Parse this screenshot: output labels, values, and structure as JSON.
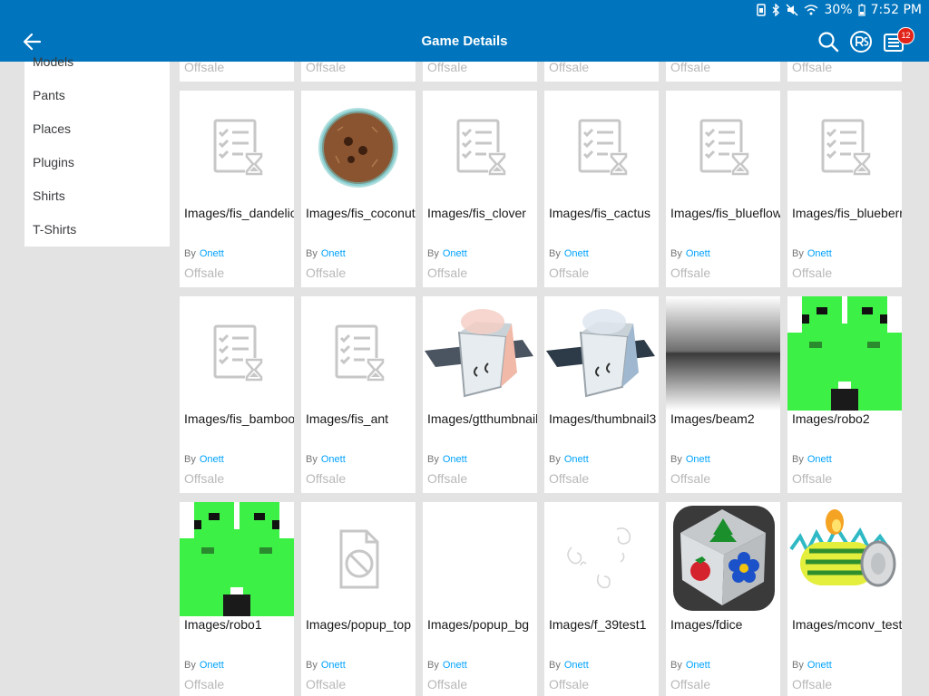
{
  "status": {
    "battery": "30%",
    "time": "7:52 PM"
  },
  "header": {
    "title": "Game Details",
    "notification_count": "12"
  },
  "sidebar": {
    "items": [
      "Models",
      "Pants",
      "Places",
      "Plugins",
      "Shirts",
      "T-Shirts"
    ]
  },
  "by_label": "By",
  "partial_row": [
    "Offsale",
    "Offsale",
    "Offsale",
    "Offsale",
    "Offsale",
    "Offsale"
  ],
  "items": [
    {
      "name": "Images/fis_dandelion",
      "creator": "Onett",
      "price": "Offsale",
      "thumb": "pending-icon"
    },
    {
      "name": "Images/fis_coconut",
      "creator": "Onett",
      "price": "Offsale",
      "thumb": "coconut-thumbnail"
    },
    {
      "name": "Images/fis_clover",
      "creator": "Onett",
      "price": "Offsale",
      "thumb": "pending-icon"
    },
    {
      "name": "Images/fis_cactus",
      "creator": "Onett",
      "price": "Offsale",
      "thumb": "pending-icon"
    },
    {
      "name": "Images/fis_blueflower",
      "creator": "Onett",
      "price": "Offsale",
      "thumb": "pending-icon"
    },
    {
      "name": "Images/fis_blueberry",
      "creator": "Onett",
      "price": "Offsale",
      "thumb": "pending-icon"
    },
    {
      "name": "Images/fis_bamboo",
      "creator": "Onett",
      "price": "Offsale",
      "thumb": "pending-icon"
    },
    {
      "name": "Images/fis_ant",
      "creator": "Onett",
      "price": "Offsale",
      "thumb": "pending-icon"
    },
    {
      "name": "Images/gtthumbnail",
      "creator": "Onett",
      "price": "Offsale",
      "thumb": "pink-cube-thumbnail"
    },
    {
      "name": "Images/thumbnail3",
      "creator": "Onett",
      "price": "Offsale",
      "thumb": "blue-cube-thumbnail"
    },
    {
      "name": "Images/beam2",
      "creator": "Onett",
      "price": "Offsale",
      "thumb": "beam-gradient-thumbnail"
    },
    {
      "name": "Images/robo2",
      "creator": "Onett",
      "price": "Offsale",
      "thumb": "robo-face-thumbnail"
    },
    {
      "name": "Images/robo1",
      "creator": "Onett",
      "price": "Offsale",
      "thumb": "robo-face-thumbnail"
    },
    {
      "name": "Images/popup_top",
      "creator": "Onett",
      "price": "Offsale",
      "thumb": "unavailable-icon"
    },
    {
      "name": "Images/popup_bg",
      "creator": "Onett",
      "price": "Offsale",
      "thumb": "blank-thumbnail"
    },
    {
      "name": "Images/f_39test1",
      "creator": "Onett",
      "price": "Offsale",
      "thumb": "swirl-sketch-thumbnail"
    },
    {
      "name": "Images/fdice",
      "creator": "Onett",
      "price": "Offsale",
      "thumb": "dice-thumbnail"
    },
    {
      "name": "Images/mconv_test",
      "creator": "Onett",
      "price": "Offsale",
      "thumb": "conveyor-thumbnail"
    }
  ],
  "colors": {
    "brand_blue": "#0074bd",
    "creator_link": "#00a2ff",
    "badge_red": "#e2231a"
  }
}
